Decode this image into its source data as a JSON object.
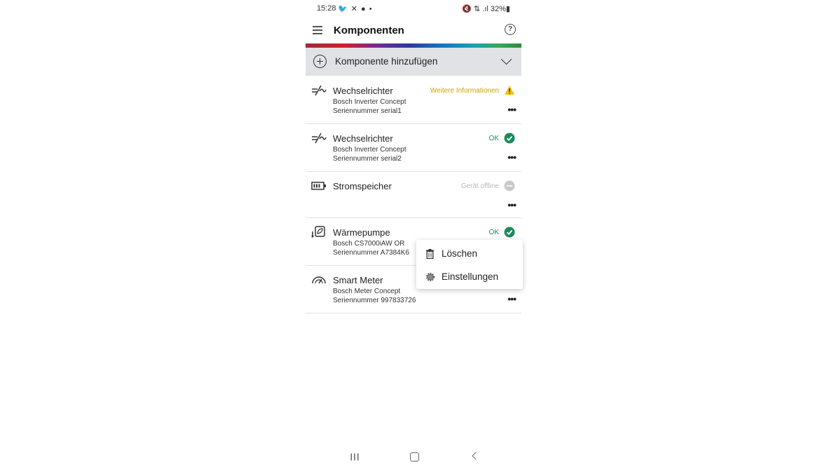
{
  "statusbar": {
    "time": "15:28",
    "notifications": "🐦 ✕ ● •",
    "system": "🔇 ⇅ .ıl 32%▮"
  },
  "appbar": {
    "title": "Komponenten"
  },
  "add_component": {
    "label": "Komponente hinzufügen"
  },
  "items": [
    {
      "name": "Wechselrichter",
      "line1": "Bosch Inverter Concept",
      "line2": "Seriennummer serial1",
      "status": "Weitere Informationen",
      "status_color": "#c9a800",
      "icon": "inverter-icon",
      "badge": "warning"
    },
    {
      "name": "Wechselrichter",
      "line1": "Bosch Inverter Concept",
      "line2": "Seriennummer serial2",
      "status": "OK",
      "status_color": "#1a8a5a",
      "icon": "inverter-icon",
      "badge": "ok"
    },
    {
      "name": "Stromspeicher",
      "line1": "",
      "line2": "",
      "status": "Gerät offline",
      "status_color": "#b9b9b9",
      "icon": "battery-icon",
      "badge": "offline"
    },
    {
      "name": "Wärmepumpe",
      "line1": "Bosch CS7000iAW OR",
      "line2": "Seriennummer A7384K6",
      "status": "OK",
      "status_color": "#1a8a5a",
      "icon": "heatpump-icon",
      "badge": "ok"
    },
    {
      "name": "Smart Meter",
      "line1": "Bosch Meter Concept",
      "line2": "Seriennummer 997833726",
      "status": "",
      "status_color": "",
      "icon": "meter-icon",
      "badge": "none"
    }
  ],
  "context_menu": {
    "delete_label": "Löschen",
    "settings_label": "Einstellungen"
  },
  "more_label": "•••",
  "colors": {
    "ok": "#1a8a5a",
    "warning": "#f2c200",
    "offline": "#c9c9c9",
    "add_bar_bg": "#e0e2e5"
  }
}
